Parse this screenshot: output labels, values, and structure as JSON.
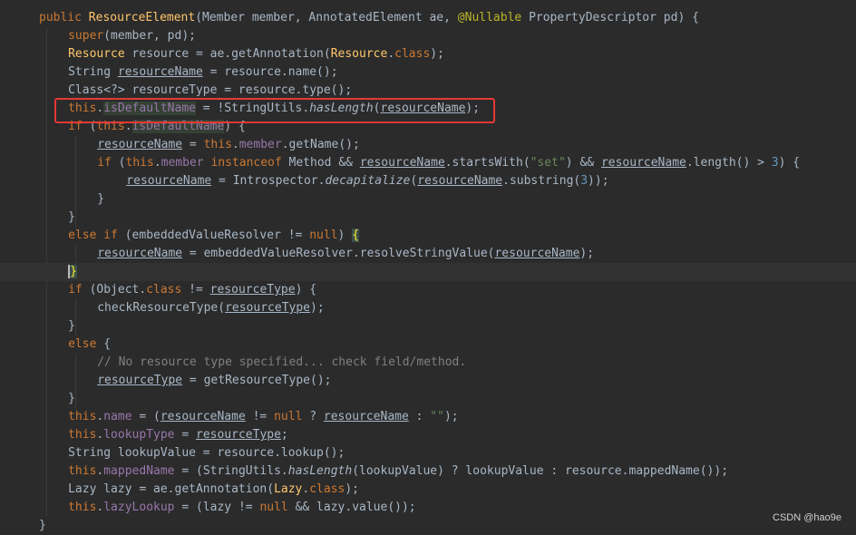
{
  "lines": [
    {
      "indent": 0,
      "spans": [
        [
          "kw",
          "public "
        ],
        [
          "cls",
          "ResourceElement"
        ],
        [
          "",
          "(Member member, AnnotatedElement ae, "
        ],
        [
          "ann",
          "@Nullable "
        ],
        [
          "",
          "PropertyDescriptor pd) {"
        ]
      ]
    },
    {
      "indent": 1,
      "spans": [
        [
          "kw",
          "super"
        ],
        [
          "",
          "(member, pd);"
        ]
      ]
    },
    {
      "indent": 1,
      "spans": [
        [
          "cls",
          "Resource "
        ],
        [
          "",
          "resource = ae.getAnnotation("
        ],
        [
          "cls",
          "Resource"
        ],
        [
          "",
          "."
        ],
        [
          "kw",
          "class"
        ],
        [
          "",
          ");"
        ]
      ]
    },
    {
      "indent": 1,
      "spans": [
        [
          "",
          "String "
        ],
        [
          "ul",
          "resourceName"
        ],
        [
          "",
          " = resource.name();"
        ]
      ]
    },
    {
      "indent": 1,
      "spans": [
        [
          "",
          "Class<?> resourceType = resource.type();"
        ]
      ]
    },
    {
      "indent": 1,
      "spans": [
        [
          "kw",
          "this"
        ],
        [
          "",
          "."
        ],
        [
          "fld hl",
          "isDefaultName"
        ],
        [
          "",
          " = !StringUtils."
        ],
        [
          "it",
          "hasLength"
        ],
        [
          "",
          "("
        ],
        [
          "ul",
          "resourceName"
        ],
        [
          "",
          ");"
        ]
      ]
    },
    {
      "indent": 1,
      "spans": [
        [
          "kw",
          "if "
        ],
        [
          "",
          "("
        ],
        [
          "kw",
          "this"
        ],
        [
          "",
          "."
        ],
        [
          "fld hl",
          "isDefaultName"
        ],
        [
          "",
          ") {"
        ]
      ]
    },
    {
      "indent": 2,
      "spans": [
        [
          "ul",
          "resourceName"
        ],
        [
          "",
          " = "
        ],
        [
          "kw",
          "this"
        ],
        [
          "",
          "."
        ],
        [
          "fld",
          "member"
        ],
        [
          "",
          ".getName();"
        ]
      ]
    },
    {
      "indent": 2,
      "spans": [
        [
          "kw",
          "if "
        ],
        [
          "",
          "("
        ],
        [
          "kw",
          "this"
        ],
        [
          "",
          "."
        ],
        [
          "fld",
          "member "
        ],
        [
          "kw",
          "instanceof "
        ],
        [
          "",
          "Method && "
        ],
        [
          "ul",
          "resourceName"
        ],
        [
          "",
          ".startsWith("
        ],
        [
          "str",
          "\"set\""
        ],
        [
          "",
          ") && "
        ],
        [
          "ul",
          "resourceName"
        ],
        [
          "",
          ".length() > "
        ],
        [
          "num",
          "3"
        ],
        [
          "",
          ") {"
        ]
      ]
    },
    {
      "indent": 3,
      "spans": [
        [
          "ul",
          "resourceName"
        ],
        [
          "",
          " = Introspector."
        ],
        [
          "it",
          "decapitalize"
        ],
        [
          "",
          "("
        ],
        [
          "ul",
          "resourceName"
        ],
        [
          "",
          ".substring("
        ],
        [
          "num",
          "3"
        ],
        [
          "",
          "));"
        ]
      ]
    },
    {
      "indent": 2,
      "spans": [
        [
          "",
          "}"
        ]
      ]
    },
    {
      "indent": 1,
      "spans": [
        [
          "",
          "}"
        ]
      ]
    },
    {
      "indent": 1,
      "spans": [
        [
          "kw",
          "else if "
        ],
        [
          "",
          "(embeddedValueResolver != "
        ],
        [
          "kw",
          "null"
        ],
        [
          "",
          ") "
        ],
        [
          "bm",
          "{"
        ]
      ]
    },
    {
      "indent": 2,
      "spans": [
        [
          "ul",
          "resourceName"
        ],
        [
          "",
          " = embeddedValueResolver.resolveStringValue("
        ],
        [
          "ul",
          "resourceName"
        ],
        [
          "",
          ");"
        ]
      ]
    },
    {
      "indent": 1,
      "spans": [
        [
          "bm caret",
          "}"
        ]
      ]
    },
    {
      "indent": 1,
      "spans": [
        [
          "kw",
          "if "
        ],
        [
          "",
          "(Object."
        ],
        [
          "kw",
          "class "
        ],
        [
          "",
          "!= "
        ],
        [
          "ul",
          "resourceType"
        ],
        [
          "",
          ") {"
        ]
      ]
    },
    {
      "indent": 2,
      "spans": [
        [
          "",
          "checkResourceType("
        ],
        [
          "ul",
          "resourceType"
        ],
        [
          "",
          ");"
        ]
      ]
    },
    {
      "indent": 1,
      "spans": [
        [
          "",
          "}"
        ]
      ]
    },
    {
      "indent": 1,
      "spans": [
        [
          "kw",
          "else "
        ],
        [
          "",
          "{"
        ]
      ]
    },
    {
      "indent": 2,
      "spans": [
        [
          "cmt",
          "// No resource type specified... check field/method."
        ]
      ]
    },
    {
      "indent": 2,
      "spans": [
        [
          "ul",
          "resourceType"
        ],
        [
          "",
          " = getResourceType();"
        ]
      ]
    },
    {
      "indent": 1,
      "spans": [
        [
          "",
          "}"
        ]
      ]
    },
    {
      "indent": 1,
      "spans": [
        [
          "kw",
          "this"
        ],
        [
          "",
          "."
        ],
        [
          "fld",
          "name"
        ],
        [
          "",
          " = ("
        ],
        [
          "ul",
          "resourceName"
        ],
        [
          "",
          " != "
        ],
        [
          "kw",
          "null "
        ],
        [
          "",
          "? "
        ],
        [
          "ul",
          "resourceName"
        ],
        [
          "",
          " : "
        ],
        [
          "str",
          "\"\""
        ],
        [
          "",
          ");"
        ]
      ]
    },
    {
      "indent": 1,
      "spans": [
        [
          "kw",
          "this"
        ],
        [
          "",
          "."
        ],
        [
          "fld",
          "lookupType"
        ],
        [
          "",
          " = "
        ],
        [
          "ul",
          "resourceType"
        ],
        [
          "",
          ";"
        ]
      ]
    },
    {
      "indent": 1,
      "spans": [
        [
          "",
          "String lookupValue = resource.lookup();"
        ]
      ]
    },
    {
      "indent": 1,
      "spans": [
        [
          "kw",
          "this"
        ],
        [
          "",
          "."
        ],
        [
          "fld",
          "mappedName"
        ],
        [
          "",
          " = (StringUtils."
        ],
        [
          "it",
          "hasLength"
        ],
        [
          "",
          "(lookupValue) ? lookupValue : resource.mappedName());"
        ]
      ]
    },
    {
      "indent": 1,
      "spans": [
        [
          "",
          "Lazy lazy = ae.getAnnotation("
        ],
        [
          "cls",
          "Lazy"
        ],
        [
          "",
          "."
        ],
        [
          "kw",
          "class"
        ],
        [
          "",
          ");"
        ]
      ]
    },
    {
      "indent": 1,
      "spans": [
        [
          "kw",
          "this"
        ],
        [
          "",
          "."
        ],
        [
          "fld",
          "lazyLookup"
        ],
        [
          "",
          " = (lazy != "
        ],
        [
          "kw",
          "null "
        ],
        [
          "",
          "&& lazy.value());"
        ]
      ]
    },
    {
      "indent": 0,
      "spans": [
        [
          "",
          "}"
        ]
      ]
    }
  ],
  "current_line": 14,
  "highlighted_line": 5,
  "watermark": "CSDN @hao9e",
  "colors": {
    "background": "#2b2b2b",
    "keyword": "#cc7832",
    "annotation": "#bbb529",
    "field": "#9876aa",
    "string": "#6a8759",
    "number": "#6897bb",
    "comment": "#808080",
    "highlight_box": "#e53935"
  }
}
